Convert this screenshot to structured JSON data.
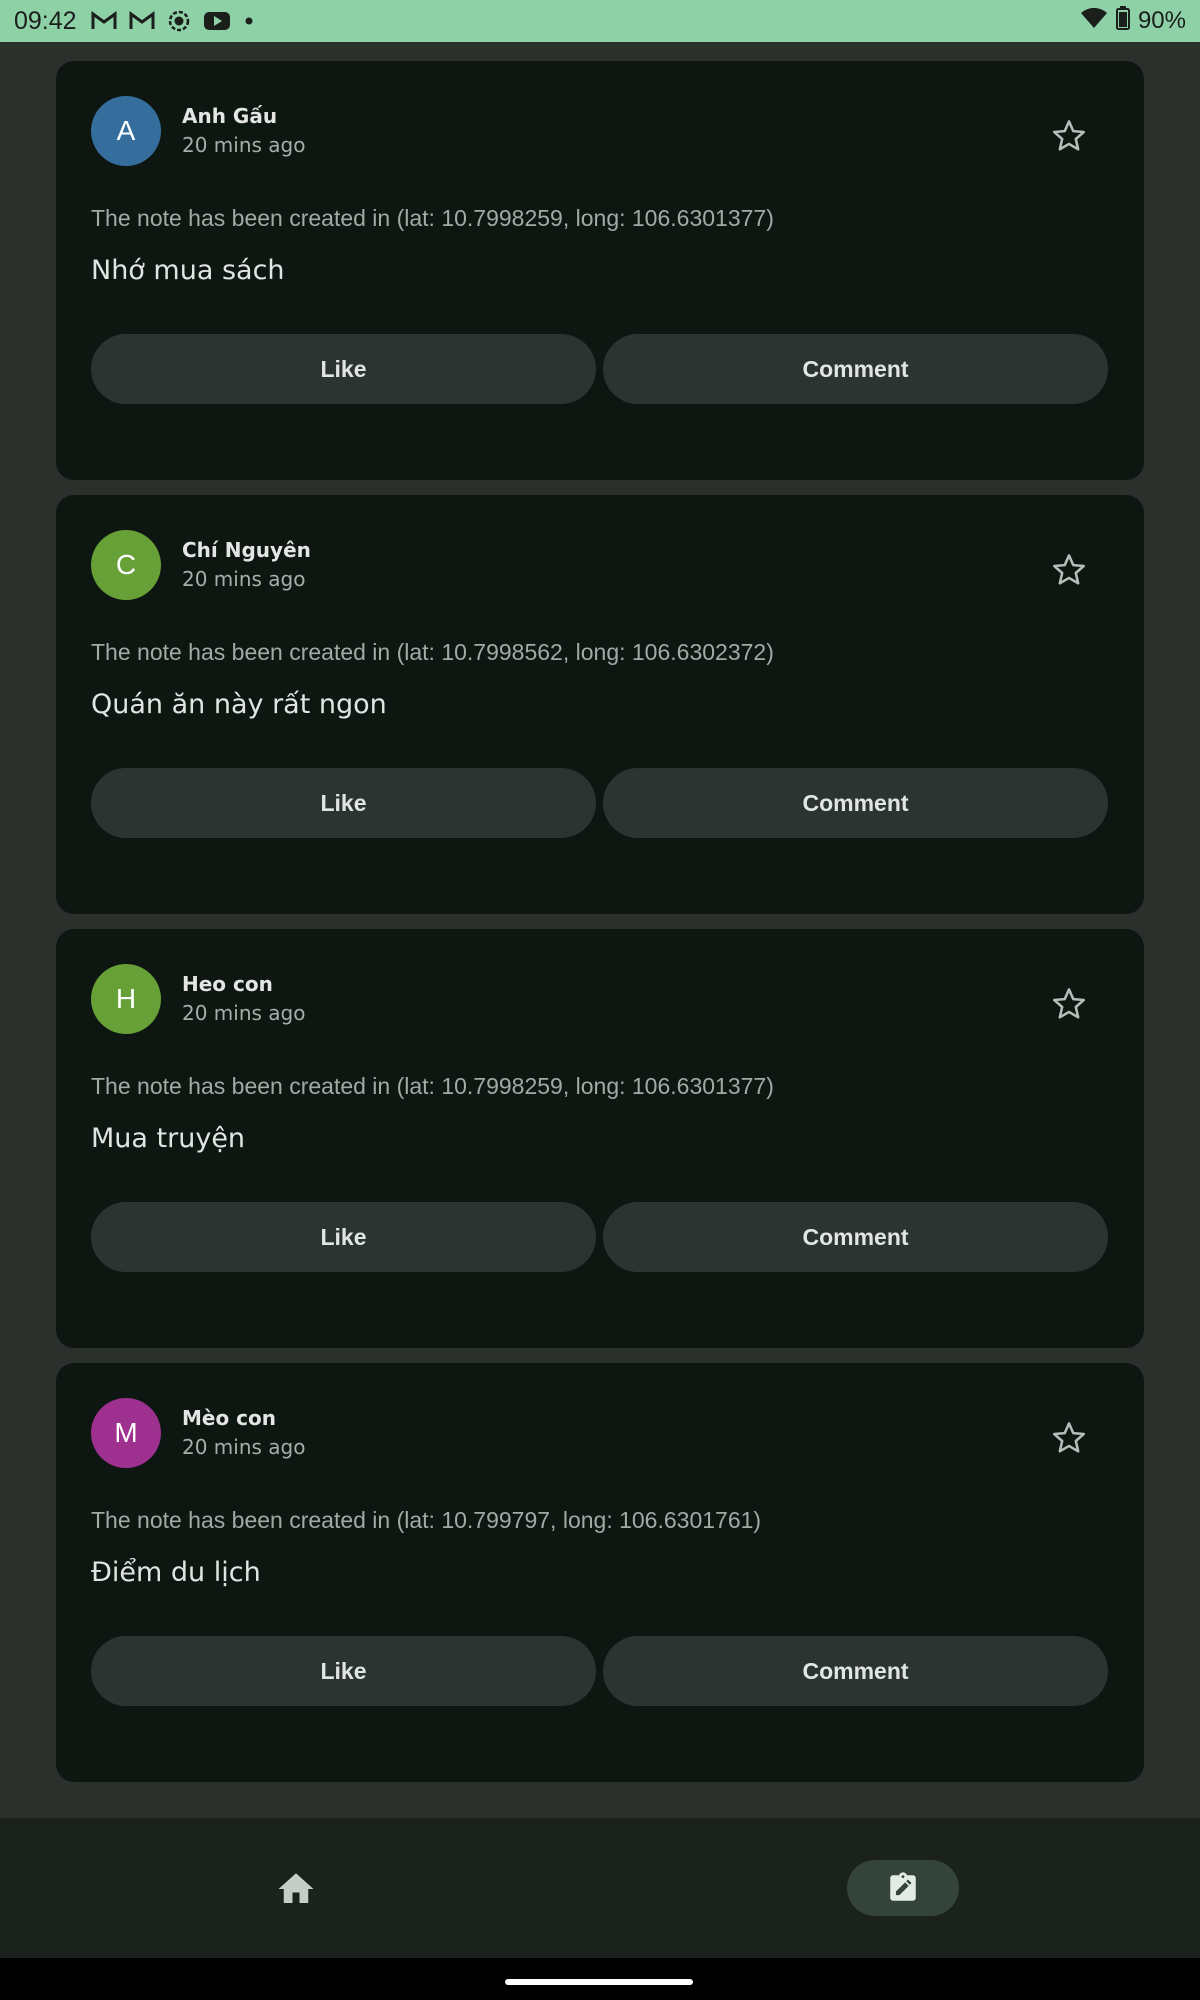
{
  "status_bar": {
    "time": "09:42",
    "battery": "90%",
    "icons": [
      "gmail-icon",
      "gmail-icon",
      "screen-record-icon",
      "youtube-icon",
      "dot-icon",
      "wifi-icon",
      "battery-icon"
    ]
  },
  "posts": [
    {
      "avatar_letter": "A",
      "avatar_color": "#356e9c",
      "name": "Anh Gấu",
      "time": "20 mins ago",
      "location": "The note has been created in (lat: 10.7998259, long: 106.6301377)",
      "note": "Nhớ mua sách",
      "like_label": "Like",
      "comment_label": "Comment"
    },
    {
      "avatar_letter": "C",
      "avatar_color": "#66a036",
      "name": "Chí Nguyên",
      "time": "20 mins ago",
      "location": "The note has been created in (lat: 10.7998562, long: 106.6302372)",
      "note": "Quán ăn này rất ngon",
      "like_label": "Like",
      "comment_label": "Comment"
    },
    {
      "avatar_letter": "H",
      "avatar_color": "#66a036",
      "name": "Heo con",
      "time": "20 mins ago",
      "location": "The note has been created in (lat: 10.7998259, long: 106.6301377)",
      "note": "Mua truyện",
      "like_label": "Like",
      "comment_label": "Comment"
    },
    {
      "avatar_letter": "M",
      "avatar_color": "#9e3090",
      "name": "Mèo con",
      "time": "20 mins ago",
      "location": "The note has been created in (lat: 10.799797, long: 106.6301761)",
      "note": "Điểm du lịch",
      "like_label": "Like",
      "comment_label": "Comment"
    }
  ],
  "bottom_nav": {
    "items": [
      {
        "icon": "home-icon",
        "selected": false
      },
      {
        "icon": "edit-note-icon",
        "selected": true
      }
    ]
  },
  "colors": {
    "background": "#2b302d",
    "card": "#0e1612",
    "button": "#2c3431",
    "status_bar": "#8fd1a6",
    "nav_selected": "#34433b"
  }
}
